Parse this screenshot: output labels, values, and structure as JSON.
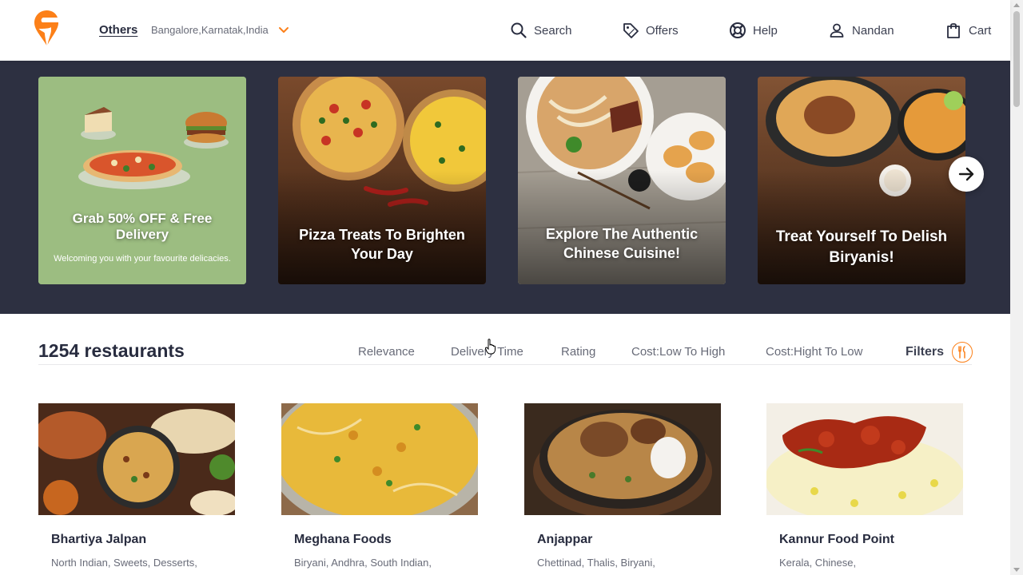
{
  "header": {
    "location_type": "Others",
    "location_address": "Bangalore,Karnatak,India",
    "nav": [
      {
        "label": "Search",
        "icon": "search-icon"
      },
      {
        "label": "Offers",
        "icon": "offer-tag-icon"
      },
      {
        "label": "Help",
        "icon": "help-lifebuoy-icon"
      },
      {
        "label": "Nandan",
        "icon": "user-icon"
      },
      {
        "label": "Cart",
        "icon": "cart-bag-icon"
      }
    ]
  },
  "banners": [
    {
      "title": "Grab 50% OFF & Free Delivery",
      "subtitle": "Welcoming you with your favourite delicacies."
    },
    {
      "title": "Pizza Treats To Brighten Your Day"
    },
    {
      "title": "Explore The Authentic Chinese Cuisine!"
    },
    {
      "title": "Treat Yourself To Delish Biryanis!"
    }
  ],
  "restaurants_section": {
    "count_label": "1254 restaurants",
    "sort_options": [
      "Relevance",
      "Delivery Time",
      "Rating",
      "Cost:Low To High",
      "Cost:Hight To Low"
    ],
    "filters_label": "Filters"
  },
  "restaurants": [
    {
      "name": "Bhartiya Jalpan",
      "cuisines": "North Indian, Sweets, Desserts,"
    },
    {
      "name": "Meghana Foods",
      "cuisines": "Biryani, Andhra, South Indian,"
    },
    {
      "name": "Anjappar",
      "cuisines": "Chettinad, Thalis, Biryani,"
    },
    {
      "name": "Kannur Food Point",
      "cuisines": "Kerala, Chinese,"
    }
  ],
  "colors": {
    "brand_orange": "#fc8019",
    "banner_bg": "#2d3041",
    "text_dark": "#282c3f",
    "text_muted": "#686b78"
  }
}
